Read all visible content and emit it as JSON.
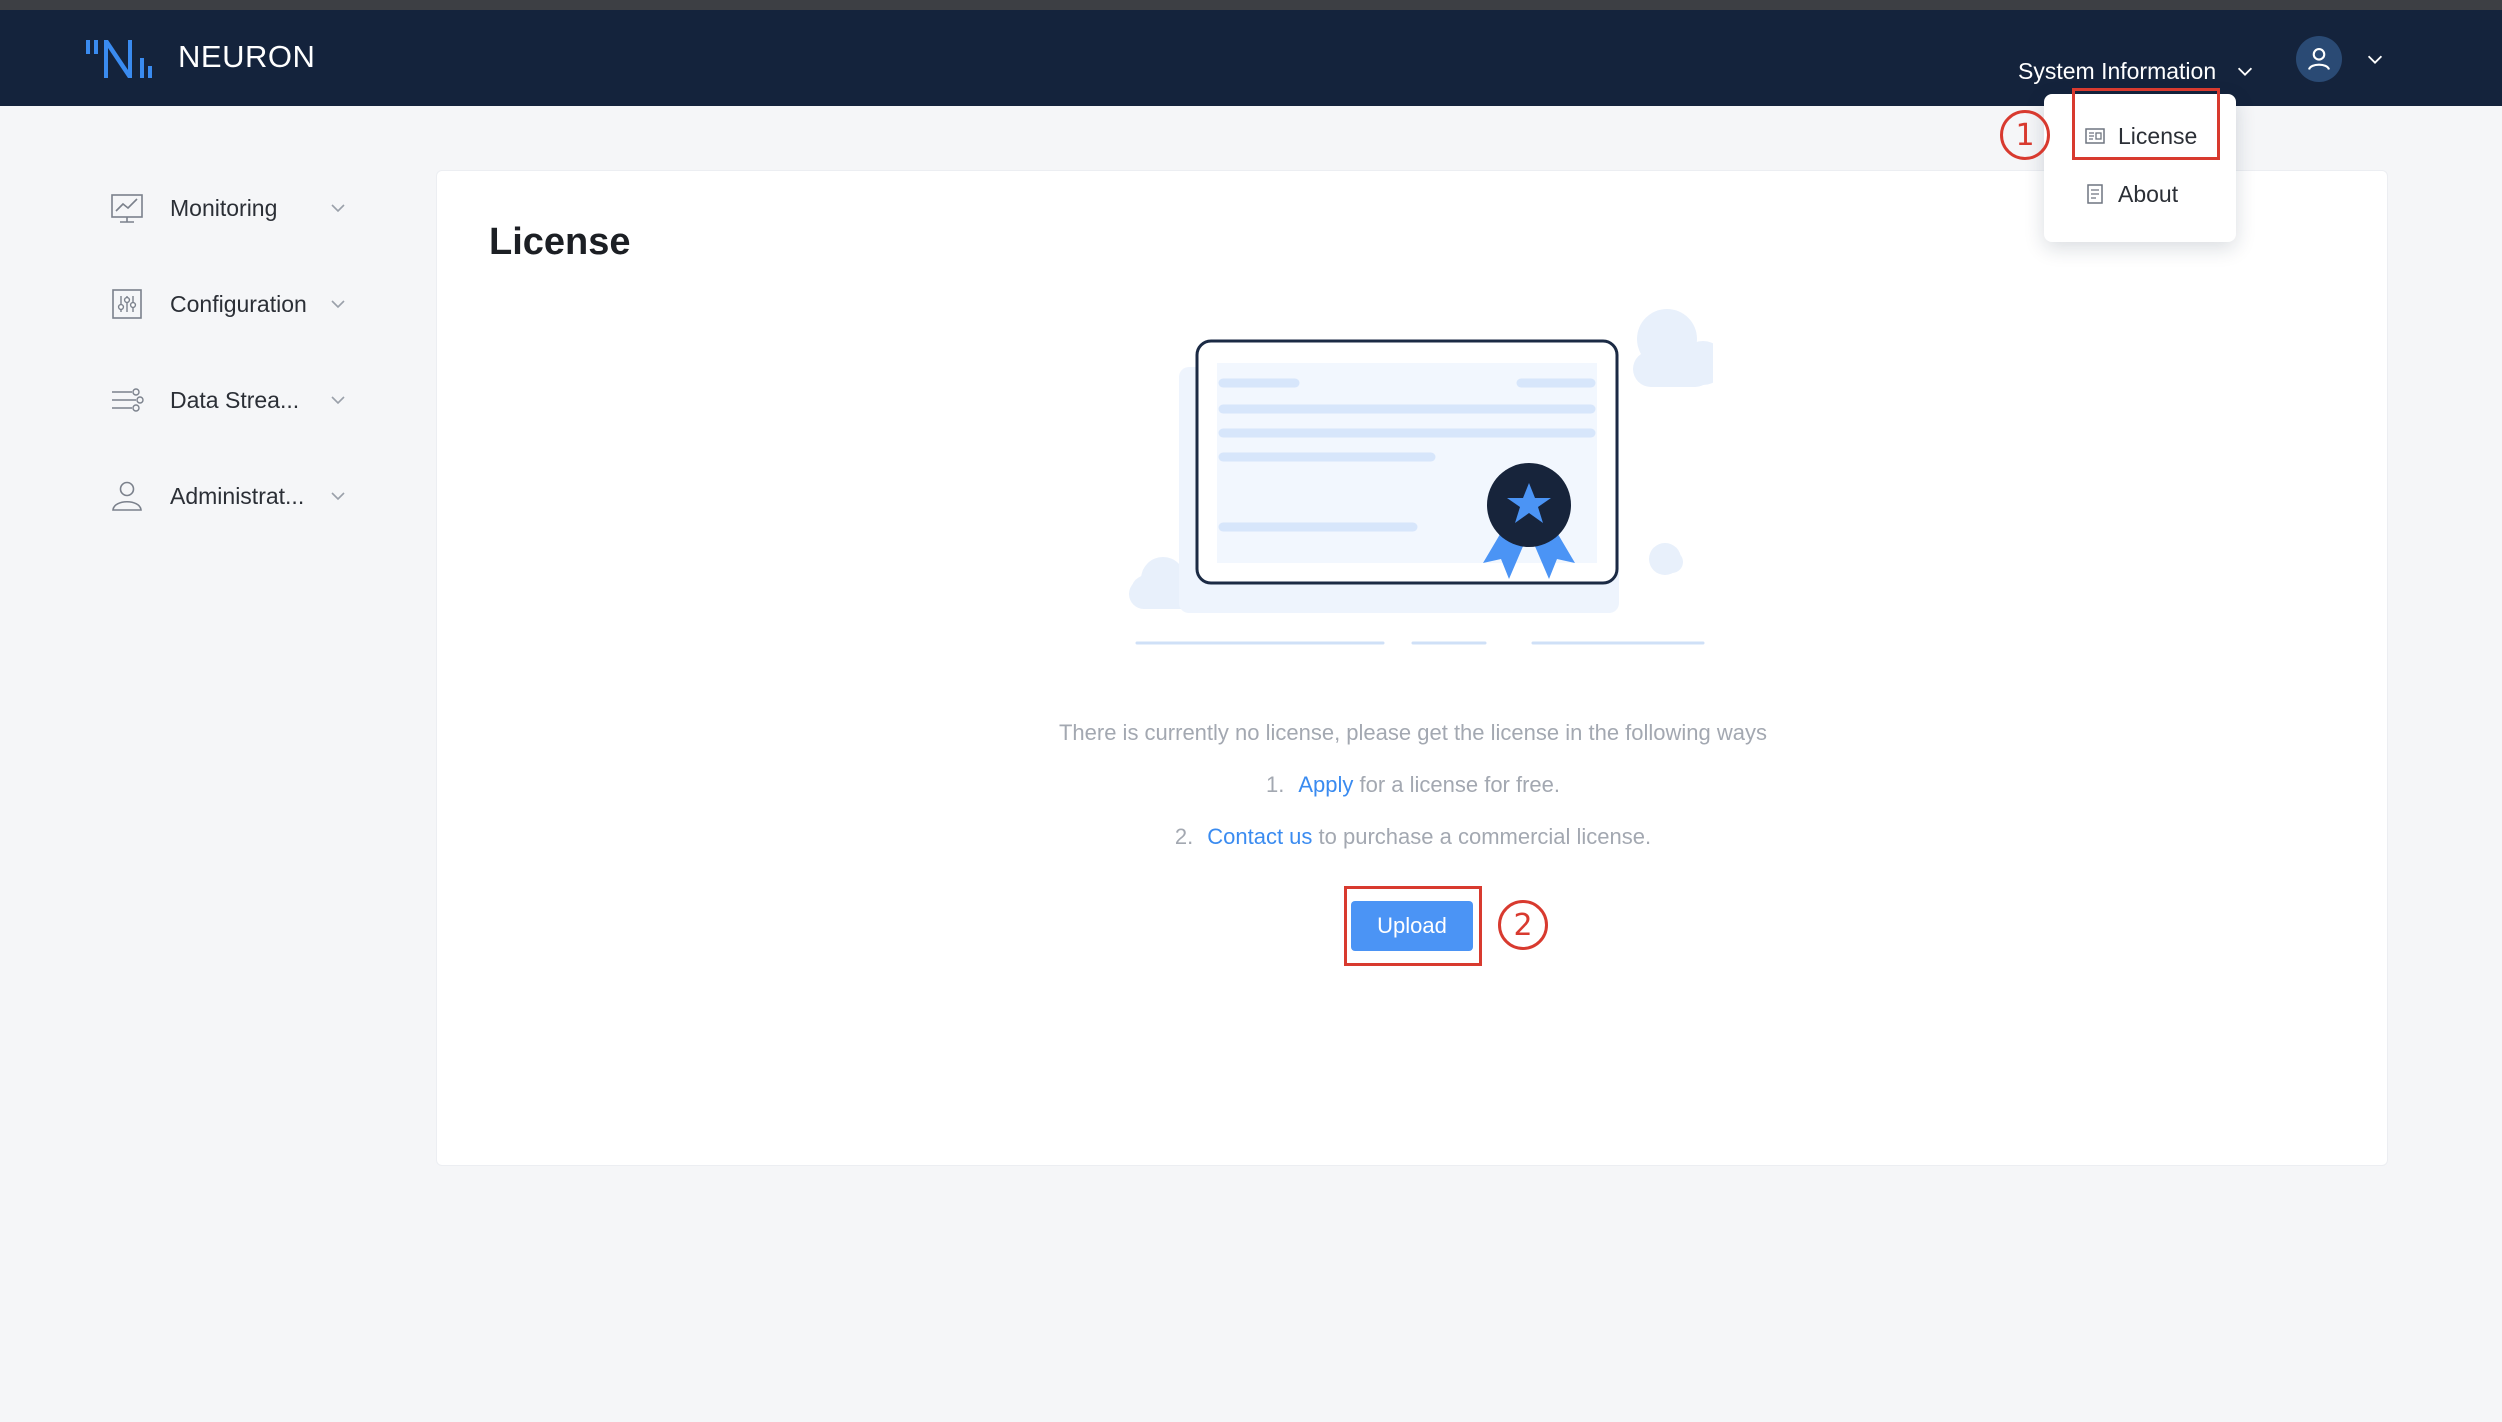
{
  "app": {
    "name": "NEURON"
  },
  "header": {
    "system_info_label": "System Information"
  },
  "sidebar": {
    "items": [
      {
        "label": "Monitoring",
        "icon": "monitor-chart-icon"
      },
      {
        "label": "Configuration",
        "icon": "sliders-icon"
      },
      {
        "label": "Data Strea...",
        "icon": "data-stream-icon"
      },
      {
        "label": "Administrat...",
        "icon": "user-icon"
      }
    ]
  },
  "dropdown": {
    "items": [
      {
        "label": "License",
        "icon": "license-icon"
      },
      {
        "label": "About",
        "icon": "document-icon"
      }
    ]
  },
  "main": {
    "title": "License",
    "message": "There is currently no license, please get the license in the following ways",
    "step1": {
      "number": "1.",
      "link": "Apply",
      "text": "for a license for free."
    },
    "step2": {
      "number": "2.",
      "link": "Contact us",
      "text": "to purchase a commercial license."
    },
    "upload_label": "Upload"
  },
  "annotations": {
    "badge1": "1",
    "badge2": "2"
  },
  "colors": {
    "header_bg": "#14233c",
    "accent": "#4b94f5",
    "link": "#3a8bf0",
    "annotation": "#d83a2f"
  }
}
